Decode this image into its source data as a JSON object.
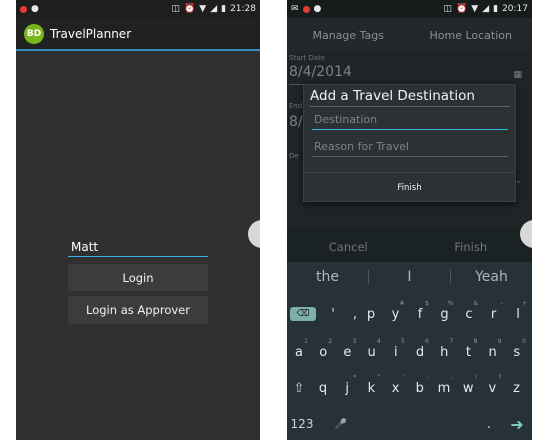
{
  "left_screen": {
    "status_bar": {
      "time": "21:28",
      "left_icons": [
        "notification-dot-icon",
        "location-pin-icon"
      ],
      "right_icons": [
        "vibrate-icon",
        "alarm-icon",
        "wifi-icon",
        "signal-icon",
        "battery-icon"
      ],
      "icon_colors": {
        "notification_dot": "#e53935"
      }
    },
    "action_bar": {
      "logo_text": "BD",
      "title": "TravelPlanner",
      "accent_color": "#2f8fb8"
    },
    "login_form": {
      "name_value": "Matt",
      "login_label": "Login",
      "approver_label": "Login as Approver"
    }
  },
  "right_screen": {
    "status_bar": {
      "time": "20:17",
      "left_icons": [
        "message-icon",
        "notification-dot-icon",
        "location-pin-icon"
      ],
      "right_icons": [
        "vibrate-icon",
        "alarm-icon",
        "wifi-icon",
        "signal-icon",
        "battery-icon"
      ]
    },
    "tabs": [
      "Manage Tags",
      "Home Location"
    ],
    "background_form": {
      "start_date_label": "Start Date",
      "start_date_value": "8/4/2014",
      "end_date_label": "End",
      "end_date_value": "8/",
      "description_label": "De"
    },
    "background_actions": {
      "cancel_label": "Cancel",
      "finish_label": "Finish"
    },
    "dialog": {
      "title": "Add a Travel Destination",
      "destination_placeholder": "Destination",
      "reason_placeholder": "Reason for Travel",
      "finish_label": "Finish"
    },
    "keyboard": {
      "suggestions": [
        "the",
        "I",
        "Yeah"
      ],
      "row1": [
        "p",
        "y",
        "f",
        "g",
        "c",
        "r",
        "l"
      ],
      "row1_hints": [
        "",
        "#",
        "$",
        "%",
        "&",
        "-",
        "+"
      ],
      "row2": [
        "a",
        "o",
        "e",
        "u",
        "i",
        "d",
        "h",
        "t",
        "n",
        "s"
      ],
      "row2_hints": [
        "1",
        "2",
        "3",
        "4",
        "5",
        "6",
        "7",
        "8",
        "9",
        "0"
      ],
      "row3": [
        "q",
        "j",
        "k",
        "x",
        "b",
        "m",
        "w",
        "v",
        "z"
      ],
      "row3_hints": [
        "",
        "*",
        "\"",
        "'",
        ":",
        ";",
        "!",
        "?",
        ""
      ],
      "delete_key": "⌫",
      "quote_key": "'",
      "comma_key": ",",
      "period_key": ".",
      "shift_key": "⇧",
      "number_key": "123",
      "mic_key": "🎤",
      "enter_key": "➜"
    }
  }
}
